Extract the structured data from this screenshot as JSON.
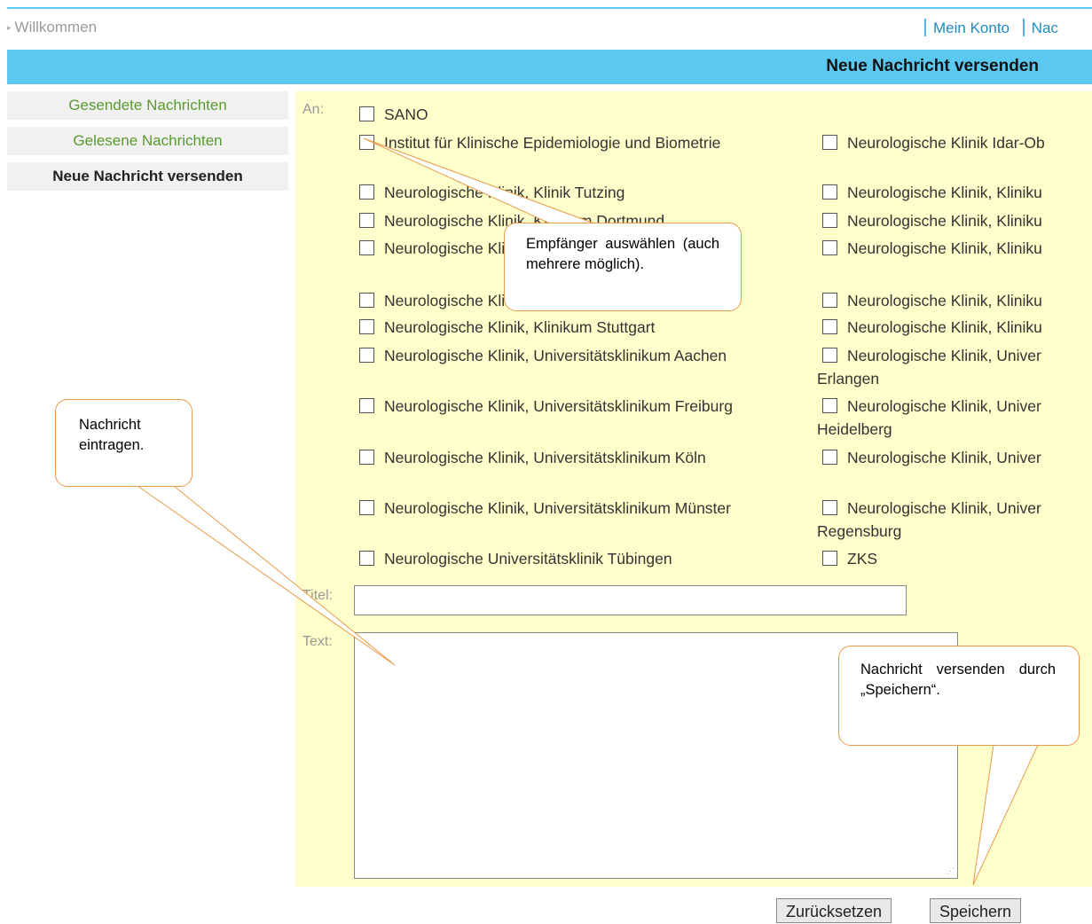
{
  "header": {
    "welcome": "Willkommen",
    "links": [
      "Mein Konto",
      "Nac"
    ],
    "banner_title": "Neue Nachricht versenden"
  },
  "sidebar": {
    "items": [
      {
        "label": "Gesendete Nachrichten"
      },
      {
        "label": "Gelesene Nachrichten"
      },
      {
        "label": "Neue Nachricht versenden"
      }
    ]
  },
  "form": {
    "to_label": "An:",
    "title_label": "Titel:",
    "text_label": "Text:",
    "title_value": "",
    "text_value": ""
  },
  "recipients": {
    "first": "SANO",
    "left": [
      "Institut für Klinische Epidemiologie und Biometrie",
      "Neurologische Klinik, Klinik Tutzing",
      "Neurologische Klinik, Klinikum Dortmund",
      "Neurologische Klinik, Klinikum",
      "Neurologische Klinik, Klinikum",
      "Neurologische Klinik, Klinikum Stuttgart",
      "Neurologische Klinik, Universitätsklinikum Aachen",
      "Neurologische Klinik, Universitätsklinikum Freiburg",
      "Neurologische Klinik, Universitätsklinikum Köln",
      "Neurologische Klinik, Universitätsklinikum Münster",
      "Neurologische Universitätsklinik Tübingen"
    ],
    "right": [
      "Neurologische Klinik Idar-Ob",
      "Neurologische Klinik, Kliniku",
      "Neurologische Klinik, Kliniku",
      "Neurologische Klinik, Kliniku",
      "Neurologische Klinik, Kliniku",
      "Neurologische Klinik, Kliniku",
      "Neurologische Klinik, Univer",
      "Neurologische Klinik, Univer",
      "Neurologische Klinik, Univer",
      "Neurologische Klinik, Univer",
      "ZKS"
    ],
    "right_wrap": [
      "Erlangen",
      "Heidelberg",
      "Regensburg"
    ]
  },
  "buttons": {
    "reset": "Zurücksetzen",
    "save": "Speichern"
  },
  "callouts": {
    "recipients": "Empfänger auswählen (auch mehrere möglich).",
    "message": "Nachricht eintragen.",
    "send": "Nachricht versenden durch „Speichern“."
  },
  "colors": {
    "banner": "#5bc8f0",
    "panel": "#ffffcc",
    "callout_border": "#e79a4a",
    "link": "#1f8bbf",
    "sidebar_green": "#5a9a2e"
  }
}
